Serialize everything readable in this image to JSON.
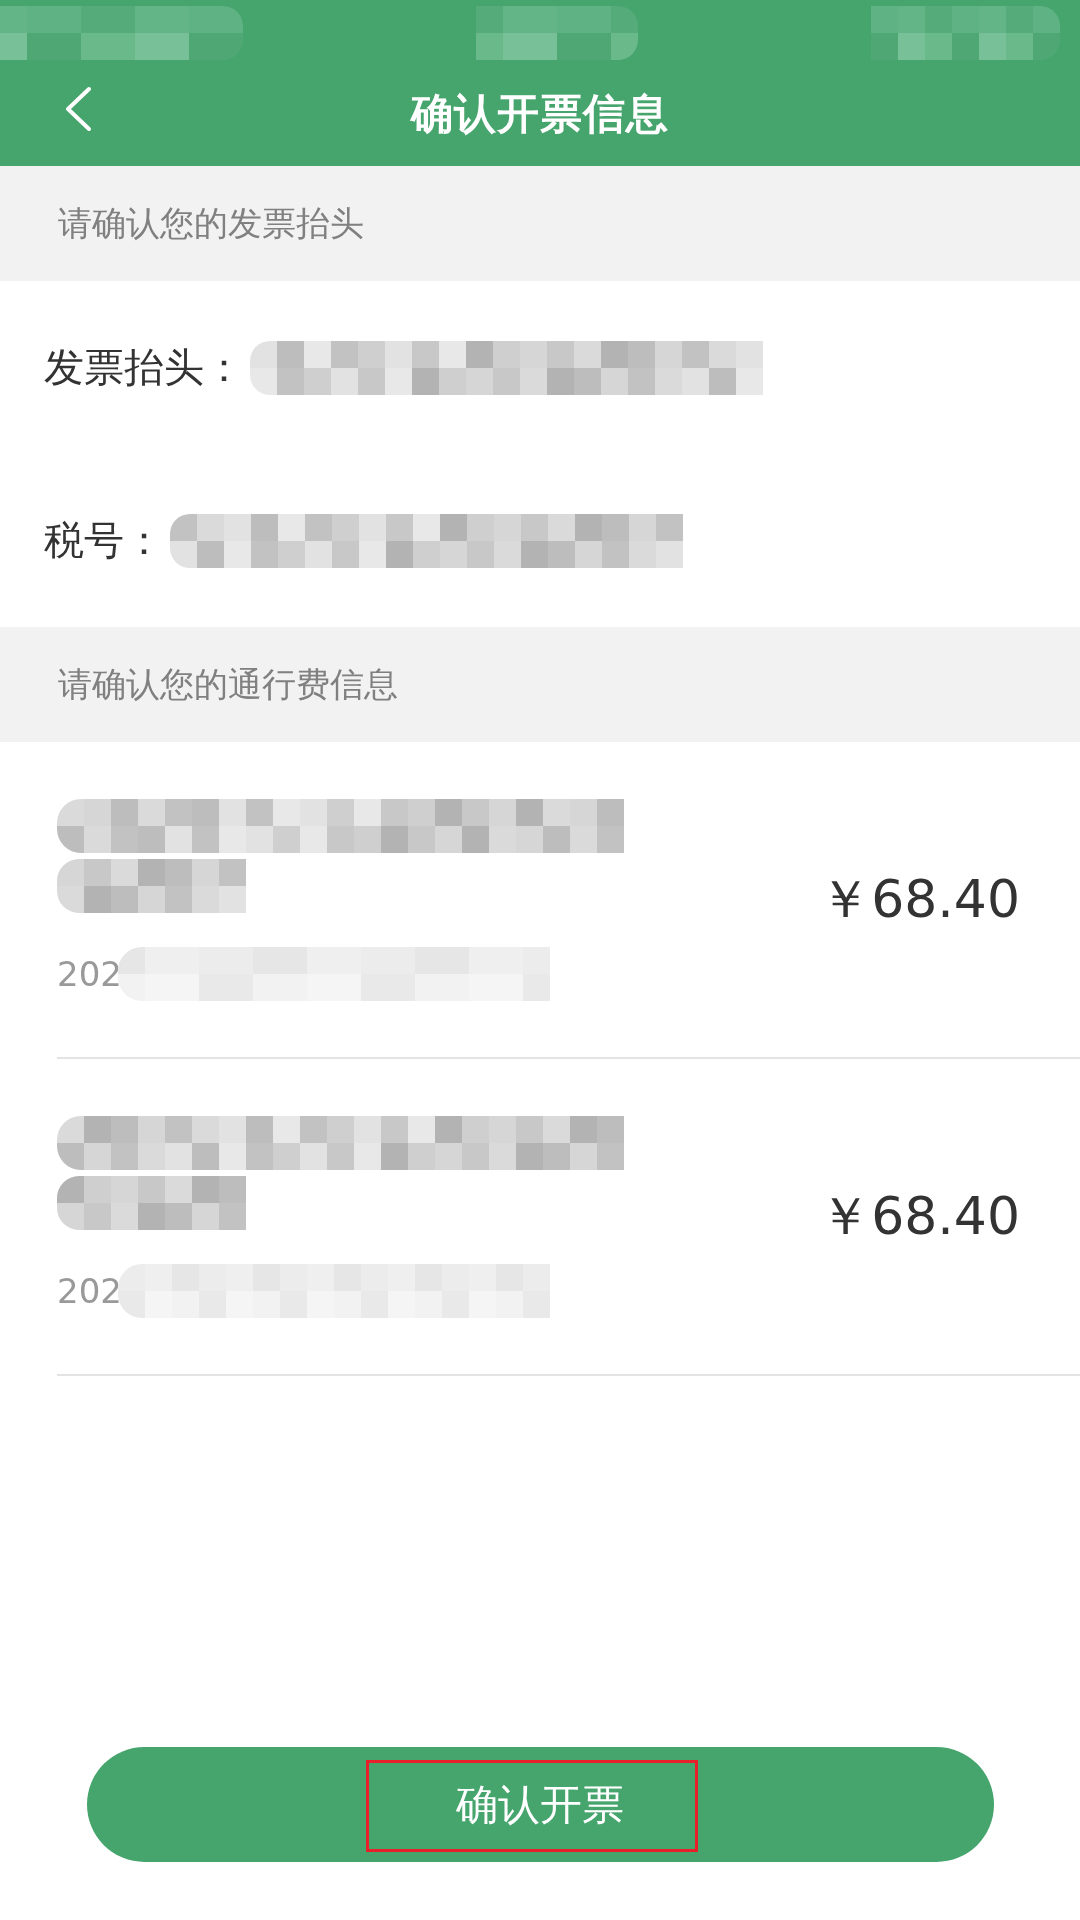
{
  "header": {
    "title": "确认开票信息"
  },
  "invoice_section": {
    "heading": "请确认您的发票抬头",
    "fields": [
      {
        "label": "发票抬头："
      },
      {
        "label": "税号："
      }
    ]
  },
  "toll_section": {
    "heading": "请确认您的通行费信息",
    "items": [
      {
        "date": "202",
        "amount": "￥68.40"
      },
      {
        "date": "202",
        "amount": "￥68.40"
      }
    ]
  },
  "confirm_button": {
    "label": "确认开票",
    "highlighted": true
  }
}
